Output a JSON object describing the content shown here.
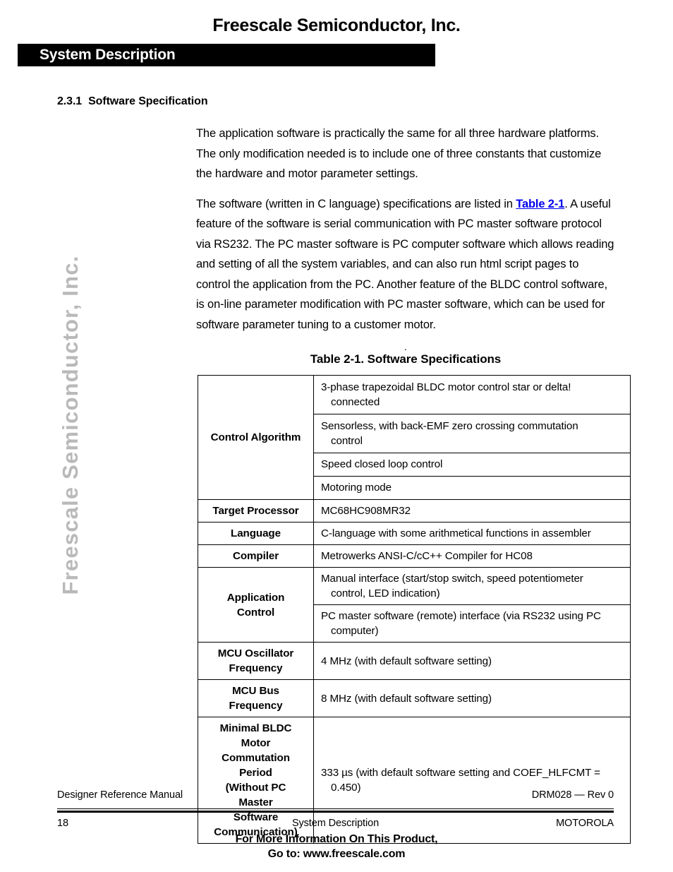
{
  "watermark": {
    "text": "Freescale Semiconductor, Inc.",
    "color": "#b9b9b9"
  },
  "header": {
    "title": "Freescale Semiconductor, Inc.",
    "chapter_bar_label": "System Description",
    "chapter_bar_color": "#000000"
  },
  "section": {
    "number": "2.3.1",
    "title": "Software Specification"
  },
  "body": {
    "paragraph_1": "The application software is practically the same for all three hardware platforms. The only modification needed is to include one of three constants that customize the hardware and motor parameter settings.",
    "paragraph_2_part_1": "The software (written in C language) specifications are listed in ",
    "paragraph_2_xref": "Table 2-1",
    "paragraph_2_xref_color": "#0000ee",
    "paragraph_2_part_2": ". A useful feature of the software is serial communication with PC master software protocol via RS232. The PC master software is PC computer software which allows reading and setting of all the system variables, and can also run html script pages to control the application from the PC. Another feature of the BLDC control software, is on-line parameter modification with PC master software, which can be used for software parameter tuning to a customer motor."
  },
  "table": {
    "stray_dot": ".",
    "caption": "Table 2-1. Software Specifications",
    "rows": [
      {
        "key": "Control Algorithm",
        "values": [
          {
            "line1": "3-phase trapezoidal BLDC motor control star or delta!",
            "line2": "connected"
          },
          {
            "line1": "Sensorless, with back-EMF zero crossing commutation",
            "line2": "control"
          },
          {
            "line1": "Speed closed loop control",
            "line2": ""
          },
          {
            "line1": "Motoring mode",
            "line2": ""
          }
        ]
      },
      {
        "key": "Target Processor",
        "values": [
          {
            "line1": "MC68HC908MR32",
            "line2": ""
          }
        ]
      },
      {
        "key": "Language",
        "values": [
          {
            "line1": "C-language with some arithmetical functions in assembler",
            "line2": ""
          }
        ]
      },
      {
        "key": "Compiler",
        "values": [
          {
            "line1": "Metrowerks ANSI-C/cC++ Compiler for HC08",
            "line2": ""
          }
        ]
      },
      {
        "key": "Application Control",
        "key_lines": [
          "Application",
          "Control"
        ],
        "values": [
          {
            "line1": "Manual interface (start/stop switch, speed potentiometer",
            "line2": "control, LED indication)"
          },
          {
            "line1": "PC master software (remote) interface (via RS232 using PC",
            "line2": "computer)"
          }
        ]
      },
      {
        "key": "MCU Oscillator Frequency",
        "key_lines": [
          "MCU Oscillator",
          "Frequency"
        ],
        "values": [
          {
            "line1": "4 MHz (with default software setting)",
            "line2": ""
          }
        ]
      },
      {
        "key": "MCU Bus Frequency",
        "key_lines": [
          "MCU Bus",
          "Frequency"
        ],
        "values": [
          {
            "line1": "8 MHz (with default software setting)",
            "line2": ""
          }
        ]
      },
      {
        "key": "Minimal BLDC Motor Commutation Period (Without PC Master Software Communication)",
        "key_lines": [
          "Minimal BLDC",
          "Motor",
          "Commutation",
          "Period",
          "(Without PC",
          "Master",
          "Software",
          "Communication)"
        ],
        "values": [
          {
            "line1": "333 µs (with default software setting and COEF_HLFCMT =",
            "line2": "0.450)"
          }
        ]
      }
    ]
  },
  "footer": {
    "manual_name": "Designer Reference Manual",
    "document_rev": "DRM028 — Rev 0",
    "page_number": "18",
    "chapter_name": "System Description",
    "company": "MOTOROLA",
    "promo_line_1": "For More Information On This Product,",
    "promo_line_2": "Go to: www.freescale.com"
  }
}
